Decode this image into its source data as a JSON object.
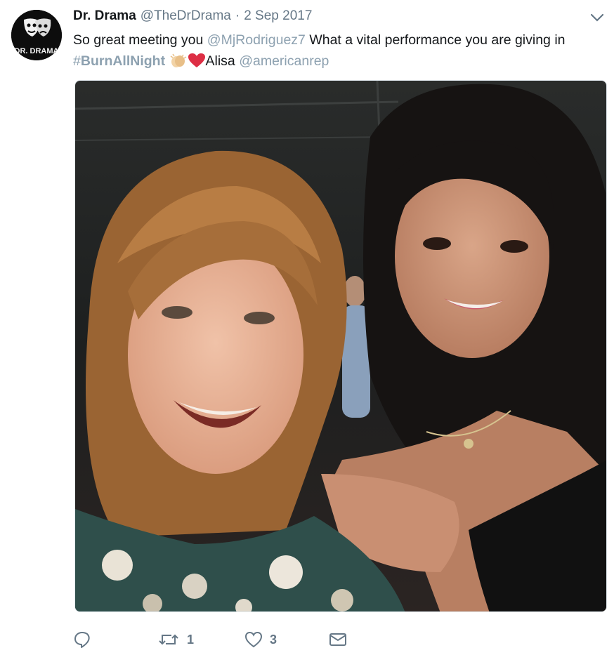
{
  "tweet": {
    "author_name": "Dr. Drama",
    "author_handle": "@TheDrDrama",
    "separator": "·",
    "date": "2 Sep 2017",
    "avatar_text": "DR. DRAMA",
    "avatar_icon": "theatre-masks",
    "text_part1": "So great meeting you ",
    "mention1": "@MjRodriguez7",
    "text_part2": " What a vital performance you are giving in ",
    "hashtag_symbol": "#",
    "hashtag_word": "BurnAllNight",
    "emoji1": "clapping-hands-emoji",
    "emoji2": "red-heart-emoji",
    "text_part3": "Alisa ",
    "mention2": "@americanrep",
    "photo_description_icon": "selfie-photo"
  },
  "actions": {
    "reply_count": "",
    "retweet_count": "1",
    "like_count": "3"
  },
  "colors": {
    "link": "#8da1b0",
    "text": "#14171a",
    "muted": "#657786",
    "heart": "#e0245e"
  }
}
